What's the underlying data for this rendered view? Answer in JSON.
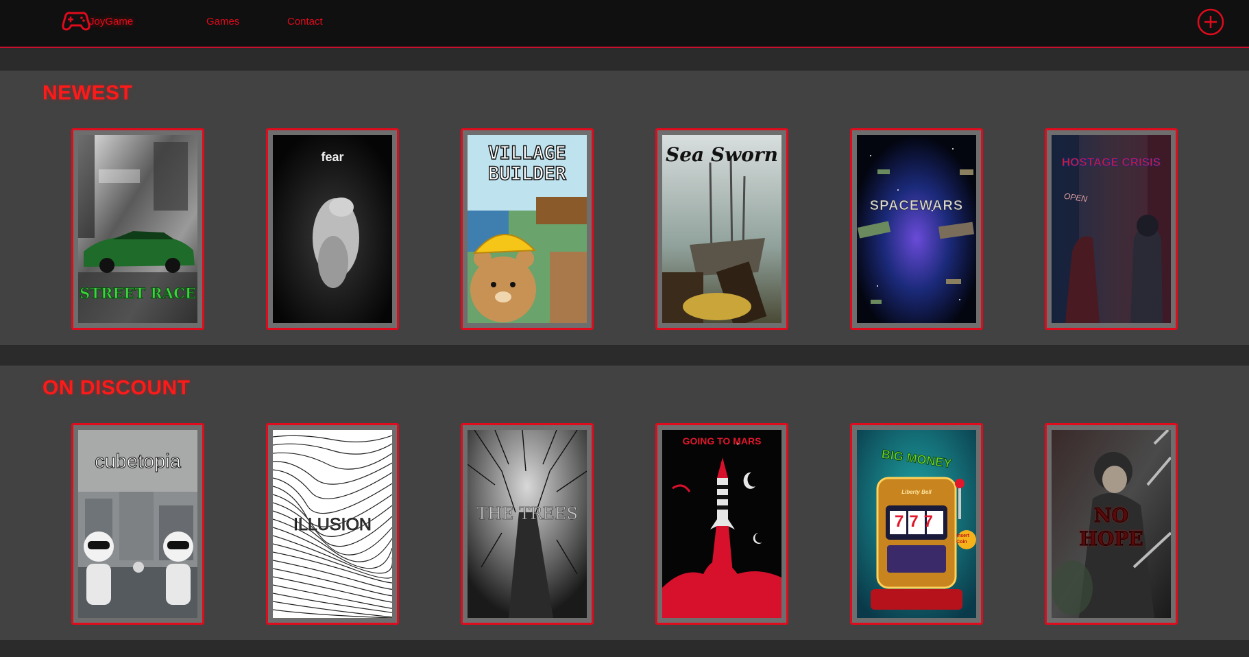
{
  "app": {
    "logo_text": "JoyGame"
  },
  "nav": {
    "games": "Games",
    "contact": "Contact"
  },
  "sections": [
    {
      "title": "NEWEST",
      "games": [
        {
          "title": "STREET RACE"
        },
        {
          "title": "fear"
        },
        {
          "title": "VILLAGE BUILDER",
          "line1": "VILLAGE",
          "line2": "BUILDER"
        },
        {
          "title": "Sea Sworn"
        },
        {
          "title": "SPACEWARS"
        },
        {
          "title": "HOSTAGE CRISIS",
          "sign": "OPEN"
        }
      ]
    },
    {
      "title": "ON DISCOUNT",
      "games": [
        {
          "title": "cubetopia"
        },
        {
          "title": "ILLUSION"
        },
        {
          "title": "THE TREES"
        },
        {
          "title": "GOING TO MARS"
        },
        {
          "title": "BIG MONEY",
          "brand": "Liberty Bell",
          "reels": "777",
          "insert": "Insert Coin"
        },
        {
          "title": "NO HOPE",
          "line1": "NO",
          "line2": "HOPE"
        }
      ]
    }
  ],
  "colors": {
    "accent": "#e00b1c",
    "navbar_bg": "#101010",
    "section_bg": "#424242",
    "page_bg": "#2b2b2b",
    "card_frame": "#6e6e6e"
  },
  "icons": {
    "logo": "gamepad-icon",
    "add": "plus-circle-icon"
  }
}
